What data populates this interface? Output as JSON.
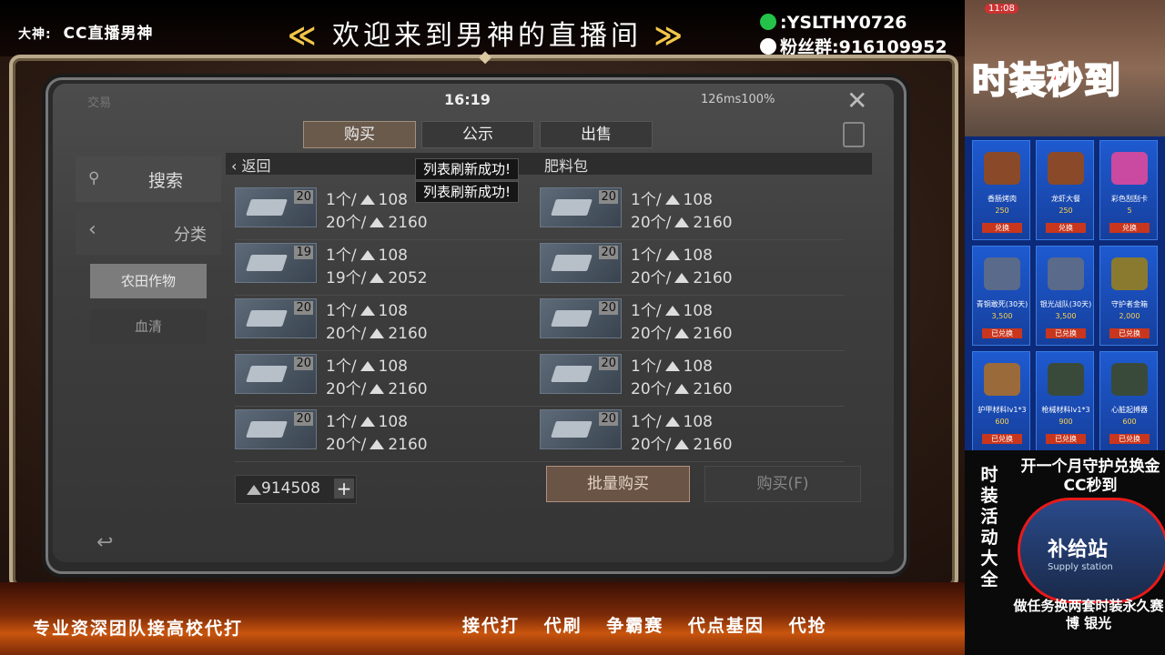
{
  "overlay": {
    "streamer_tag": "大神:",
    "streamer_name": "CC直播男神",
    "welcome_prefix": "≪",
    "welcome_text": "欢迎来到男神的直播间",
    "welcome_suffix": "≫",
    "wechat": ":YSLTHY0726",
    "fans_group": "粉丝群:916109952",
    "bottom_left": "专业资深团队接高校代打",
    "bottom_services": [
      "接代打",
      "代刷",
      "争霸赛",
      "代点基因",
      "代抢"
    ]
  },
  "game": {
    "faint_label": "交易",
    "clock": "16:19",
    "status": "126ms100%",
    "close_icon": "✕",
    "tabs": [
      "购买",
      "公示",
      "出售"
    ],
    "search_label": "搜索",
    "category_label": "分类",
    "side_buttons": [
      "农田作物",
      "血清"
    ],
    "back_label": "返回",
    "category_name": "肥料包",
    "toasts": [
      "列表刷新成功!",
      "列表刷新成功!"
    ],
    "items": [
      {
        "qty": "20",
        "unit_line": "1个/",
        "unit_price": "108",
        "bulk_line": "20个/",
        "bulk_price": "2160"
      },
      {
        "qty": "20",
        "unit_line": "1个/",
        "unit_price": "108",
        "bulk_line": "20个/",
        "bulk_price": "2160"
      },
      {
        "qty": "19",
        "unit_line": "1个/",
        "unit_price": "108",
        "bulk_line": "19个/",
        "bulk_price": "2052"
      },
      {
        "qty": "20",
        "unit_line": "1个/",
        "unit_price": "108",
        "bulk_line": "20个/",
        "bulk_price": "2160"
      },
      {
        "qty": "20",
        "unit_line": "1个/",
        "unit_price": "108",
        "bulk_line": "20个/",
        "bulk_price": "2160"
      },
      {
        "qty": "20",
        "unit_line": "1个/",
        "unit_price": "108",
        "bulk_line": "20个/",
        "bulk_price": "2160"
      },
      {
        "qty": "20",
        "unit_line": "1个/",
        "unit_price": "108",
        "bulk_line": "20个/",
        "bulk_price": "2160"
      },
      {
        "qty": "20",
        "unit_line": "1个/",
        "unit_price": "108",
        "bulk_line": "20个/",
        "bulk_price": "2160"
      },
      {
        "qty": "20",
        "unit_line": "1个/",
        "unit_price": "108",
        "bulk_line": "20个/",
        "bulk_price": "2160"
      },
      {
        "qty": "20",
        "unit_line": "1个/",
        "unit_price": "108",
        "bulk_line": "20个/",
        "bulk_price": "2160"
      }
    ],
    "balance": "914508",
    "plus": "+",
    "batch_buy": "批量购买",
    "buy": "购买(F)"
  },
  "side_panel": {
    "phone_time": "11:08",
    "title": "时装秒到",
    "shop_cards": [
      {
        "name": "香肠烤肉",
        "price": "250",
        "state": "兑换"
      },
      {
        "name": "龙虾大餐",
        "price": "250",
        "state": "兑换"
      },
      {
        "name": "彩色刮刮卡",
        "price": "5",
        "state": "兑换"
      },
      {
        "name": "青铜敢死(30天)",
        "price": "3,500",
        "state": "已兑换"
      },
      {
        "name": "银光战队(30天)",
        "price": "3,500",
        "state": "已兑换"
      },
      {
        "name": "守护者金箱",
        "price": "2,000",
        "state": "已兑换"
      },
      {
        "name": "护甲材料lv1*3",
        "price": "600",
        "state": "已兑换"
      },
      {
        "name": "枪械材料lv1*3",
        "price": "900",
        "state": "已兑换"
      },
      {
        "name": "心脏起搏器",
        "price": "600",
        "state": "已兑换"
      }
    ],
    "vertical": "时装活动大全",
    "promo_top": "开一个月守护兑换金CC秒到",
    "supply_cn": "补给站",
    "supply_en": "Supply station",
    "promo_bottom": "做任务换两套时装永久赛博 银光"
  },
  "colors": {
    "accent_gold": "#f2c64a",
    "title_red": "#e8181c",
    "active_tab": "#6a5a4c"
  }
}
